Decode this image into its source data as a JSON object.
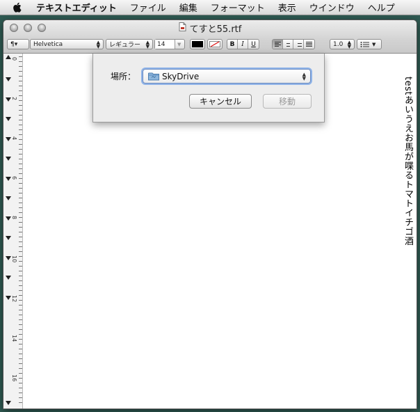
{
  "menubar": {
    "app": "テキストエディット",
    "items": [
      "ファイル",
      "編集",
      "フォーマット",
      "表示",
      "ウインドウ",
      "ヘルプ"
    ]
  },
  "window": {
    "title": "てすと55.rtf"
  },
  "toolbar": {
    "paragraph_style": "¶▾",
    "font_family": "Helvetica",
    "font_style": "レギュラー",
    "font_size": "14",
    "bold": "B",
    "italic": "I",
    "underline": "U",
    "line_spacing": "1.0",
    "text_color": "#000000"
  },
  "ruler": {
    "labels": [
      "0",
      "2",
      "4",
      "6",
      "8",
      "10",
      "12",
      "14",
      "16"
    ]
  },
  "document": {
    "text": "testあいうえお馬が喋るトマトイチゴ酒"
  },
  "sheet": {
    "location_label": "場所：",
    "location_value": "SkyDrive",
    "cancel_label": "キャンセル",
    "move_label": "移動"
  }
}
